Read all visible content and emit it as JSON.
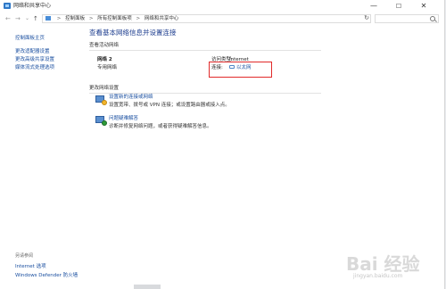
{
  "window": {
    "title": "网络和共享中心",
    "controls": {
      "minimize": "—",
      "maximize": "☐",
      "close": "✕"
    }
  },
  "address_bar": {
    "nav": {
      "back": "←",
      "forward": "→",
      "recent": "⌄",
      "up": "↑"
    },
    "breadcrumb": [
      "控制面板",
      "所有控制面板项",
      "网络和共享中心"
    ],
    "separator": ">",
    "refresh": "↻"
  },
  "sidebar": {
    "items": [
      "控制面板主页",
      "更改适配器设置",
      "更改高级共享设置",
      "媒体流式处理选项"
    ],
    "see_also_label": "另请参阅",
    "see_also": [
      "Internet 选项",
      "Windows Defender 防火墙"
    ]
  },
  "main": {
    "title": "查看基本网络信息并设置连接",
    "active_networks_heading": "查看活动网络",
    "network": {
      "name": "网络 2",
      "category": "专用网络",
      "access_type_label": "访问类型:",
      "access_type_value": "Internet",
      "connections_label": "连接:",
      "connections_value": "以太网"
    },
    "change_settings_heading": "更改网络设置",
    "tasks": [
      {
        "link": "设置新的连接或网络",
        "description": "设置宽带、拨号或 VPN 连接；或设置路由器或接入点。",
        "icon": "network-setup-icon"
      },
      {
        "link": "问题疑难解答",
        "description": "诊断并修复网络问题，或者获得疑难解答信息。",
        "icon": "troubleshoot-icon"
      }
    ]
  },
  "watermark": {
    "logo": "Bai 经验",
    "sub": "jingyan.baidu.com"
  },
  "colors": {
    "link": "#1a4fa0",
    "title": "#1d3d8f",
    "highlight_box": "#e12a2a"
  }
}
